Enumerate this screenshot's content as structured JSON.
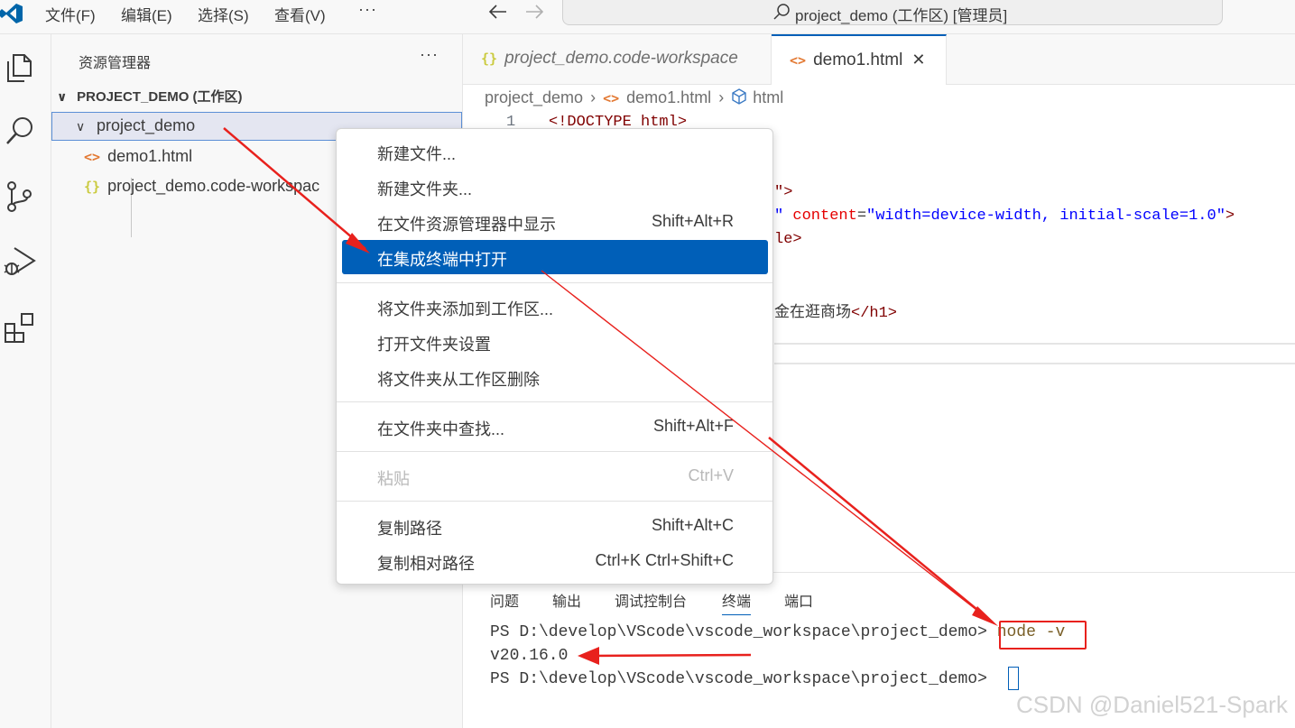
{
  "titlebar": {
    "menus": [
      "文件(F)",
      "编辑(E)",
      "选择(S)",
      "查看(V)"
    ],
    "more": "···",
    "back_icon": "arrow-left-icon",
    "forward_icon": "arrow-right-icon",
    "command_center_text": "project_demo (工作区) [管理员]"
  },
  "activity_bar": {
    "icons": [
      "explorer-icon",
      "search-icon",
      "source-control-icon",
      "run-debug-icon",
      "extensions-icon"
    ]
  },
  "sidebar": {
    "title": "资源管理器",
    "more": "···",
    "workspace_label": "PROJECT_DEMO (工作区)",
    "folder": "project_demo",
    "files": [
      {
        "name": "demo1.html",
        "icon": "<>"
      },
      {
        "name": "project_demo.code-workspac",
        "icon": "{}"
      }
    ]
  },
  "editor": {
    "tabs": [
      {
        "icon": "{}",
        "label": "project_demo.code-workspace"
      },
      {
        "icon": "<>",
        "label": "demo1.html",
        "close": "✕"
      }
    ],
    "breadcrumbs": [
      "project_demo",
      "demo1.html",
      "html"
    ],
    "breadcrumb_sep": "›",
    "line_number": "1",
    "code": {
      "line1": "<!DOCTYPE html>",
      "frag_meta_end": "\">",
      "frag_viewport_q": "\" ",
      "frag_content_attr": "content",
      "frag_eq": "=",
      "frag_content_val": "\"width=device-width, initial-scale=1.0\"",
      "frag_gt": ">",
      "frag_title_tail": "le>",
      "frag_h1_text": "金在逛商场",
      "frag_h1_close": "</h1>"
    }
  },
  "panel": {
    "tabs": [
      "问题",
      "输出",
      "调试控制台",
      "终端",
      "端口"
    ],
    "active_tab": "终端",
    "terminal": {
      "prompt": "PS D:\\develop\\VScode\\vscode_workspace\\project_demo>",
      "command": "node -v",
      "output": "v20.16.0"
    }
  },
  "context_menu": {
    "items": [
      {
        "label": "新建文件...",
        "shortcut": ""
      },
      {
        "label": "新建文件夹...",
        "shortcut": ""
      },
      {
        "label": "在文件资源管理器中显示",
        "shortcut": "Shift+Alt+R"
      },
      {
        "label": "在集成终端中打开",
        "shortcut": "",
        "highlighted": true
      },
      {
        "label": "将文件夹添加到工作区...",
        "shortcut": ""
      },
      {
        "label": "打开文件夹设置",
        "shortcut": ""
      },
      {
        "label": "将文件夹从工作区删除",
        "shortcut": ""
      },
      {
        "label": "在文件夹中查找...",
        "shortcut": "Shift+Alt+F"
      },
      {
        "label": "粘贴",
        "shortcut": "Ctrl+V",
        "disabled": true
      },
      {
        "label": "复制路径",
        "shortcut": "Shift+Alt+C"
      },
      {
        "label": "复制相对路径",
        "shortcut": "Ctrl+K Ctrl+Shift+C"
      }
    ]
  },
  "watermark": "CSDN @Daniel521-Spark",
  "colors": {
    "accent": "#005fb8",
    "annotation_red": "#e8211d",
    "html_icon": "#e37933",
    "json_icon": "#cbcb41"
  }
}
